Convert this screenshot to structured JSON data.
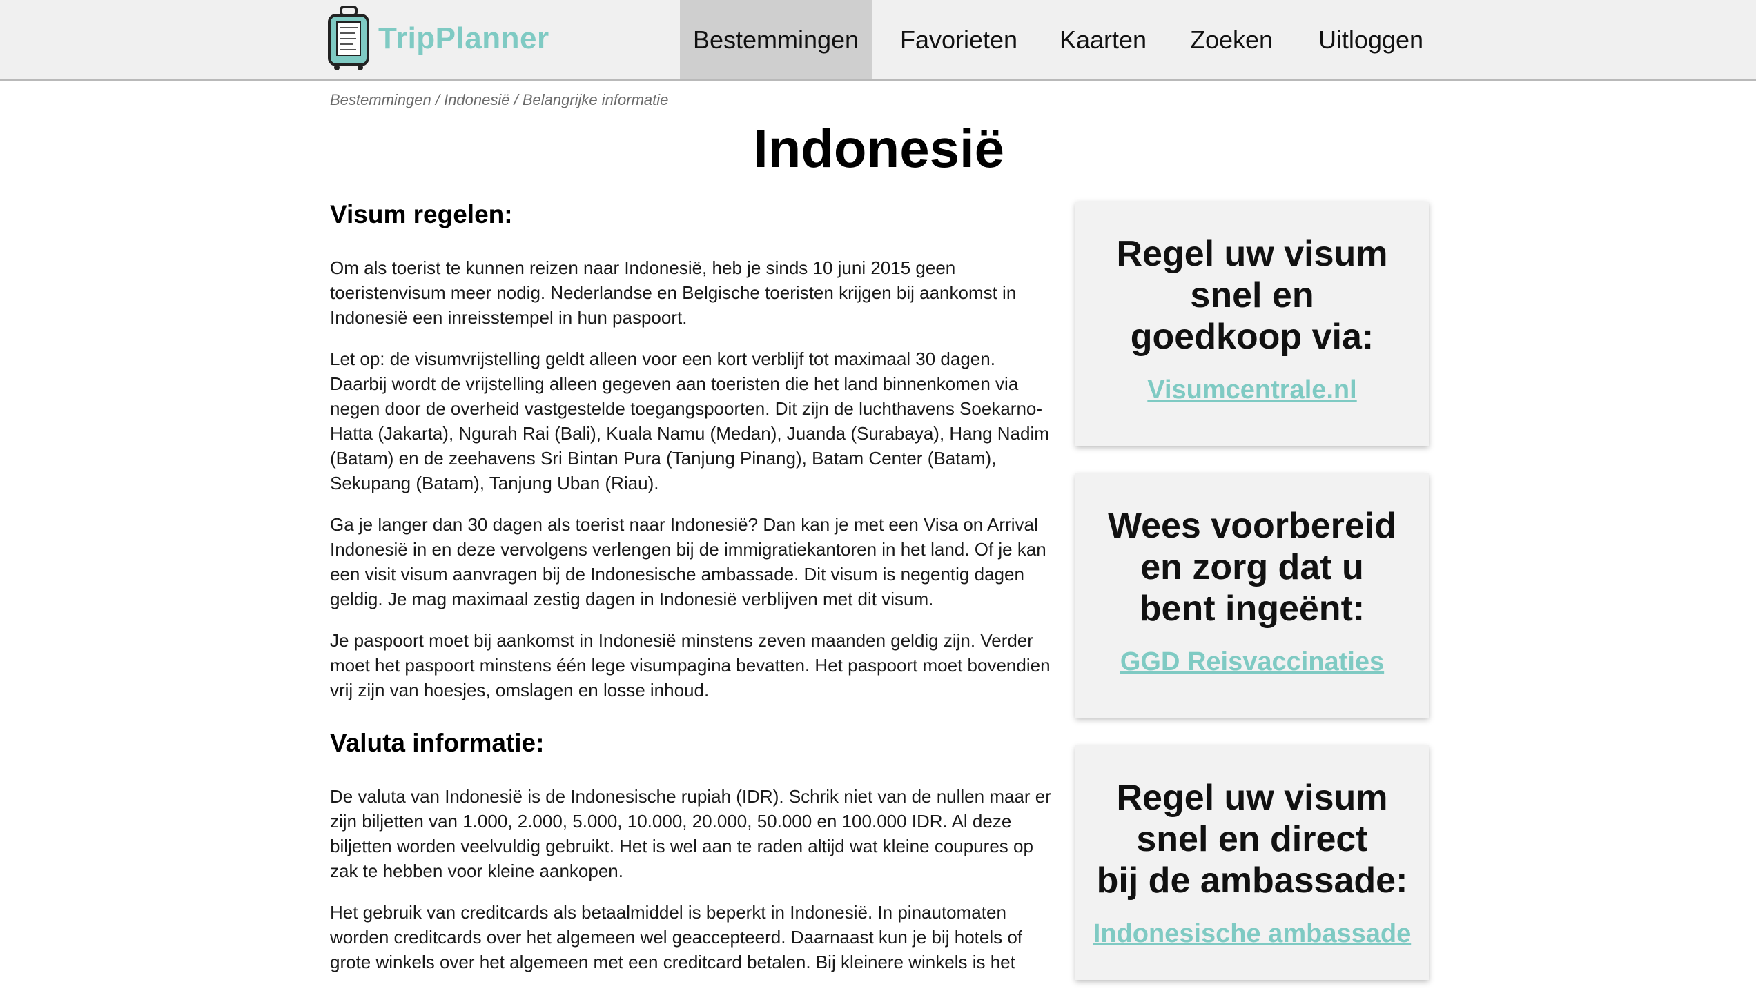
{
  "colors": {
    "brand": "#7fcac3",
    "nav_active": "#cfcfcf",
    "topbar": "#f0f0f0"
  },
  "header": {
    "logo_text": "TripPlanner",
    "logo_icon": "suitcase-icon",
    "nav": [
      {
        "label": "Bestemmingen",
        "active": true
      },
      {
        "label": "Favorieten",
        "active": false
      },
      {
        "label": "Kaarten",
        "active": false
      },
      {
        "label": "Zoeken",
        "active": false
      },
      {
        "label": "Uitloggen",
        "active": false
      }
    ]
  },
  "breadcrumb": "Bestemmingen / Indonesië / Belangrijke informatie",
  "page_title": "Indonesië",
  "main": {
    "visa_heading": "Visum regelen:",
    "visa_paragraphs": [
      "Om als toerist te kunnen reizen naar Indonesië, heb je sinds 10 juni 2015 geen toeristenvisum meer nodig. Nederlandse en Belgische toeristen krijgen bij aankomst in Indonesië een inreisstempel in hun paspoort.",
      "Let op: de visumvrijstelling geldt alleen voor een kort verblijf tot maximaal 30 dagen. Daarbij wordt de vrijstelling alleen gegeven aan toeristen die het land binnenkomen via negen door de overheid vastgestelde toegangspoorten. Dit zijn de luchthavens Soekarno-Hatta (Jakarta), Ngurah Rai (Bali), Kuala Namu (Medan), Juanda (Surabaya), Hang Nadim (Batam) en de zeehavens Sri Bintan Pura (Tanjung Pinang), Batam Center (Batam), Sekupang (Batam), Tanjung Uban (Riau).",
      "Ga je langer dan 30 dagen als toerist naar Indonesië? Dan kan je met een Visa on Arrival Indonesië in en deze vervolgens verlengen bij de immigratiekantoren in het land. Of je kan een visit visum aanvragen bij de Indonesische ambassade. Dit visum is negentig dagen geldig. Je mag maximaal zestig dagen in Indonesië verblijven met dit visum.",
      "Je paspoort moet bij aankomst in Indonesië minstens zeven maanden geldig zijn. Verder moet het paspoort minstens één lege visumpagina bevatten. Het paspoort moet bovendien vrij zijn van hoesjes, omslagen en losse inhoud."
    ],
    "currency_heading": "Valuta informatie:",
    "currency_paragraphs": [
      "De valuta van Indonesië is de Indonesische rupiah (IDR). Schrik niet van de nullen maar er zijn biljetten van 1.000, 2.000, 5.000, 10.000, 20.000, 50.000 en 100.000 IDR. Al deze biljetten worden veelvuldig gebruikt. Het is wel aan te raden altijd wat kleine coupures op zak te hebben voor kleine aankopen.",
      "Het gebruik van creditcards als betaalmiddel is beperkt in Indonesië. In pinautomaten worden creditcards over het algemeen wel geaccepteerd. Daarnaast kun je bij hotels of grote winkels over het algemeen met een creditcard betalen. Bij kleinere winkels is het"
    ]
  },
  "sidebar": [
    {
      "heading": "Regel uw visum\nsnel en\ngoedkoop via:",
      "link": "Visumcentrale.nl"
    },
    {
      "heading": "Wees voorbereid\nen zorg dat u\nbent ingeënt:",
      "link": "GGD Reisvaccinaties"
    },
    {
      "heading": "Regel uw visum\nsnel en direct\nbij de ambassade:",
      "link": "Indonesische ambassade"
    }
  ]
}
